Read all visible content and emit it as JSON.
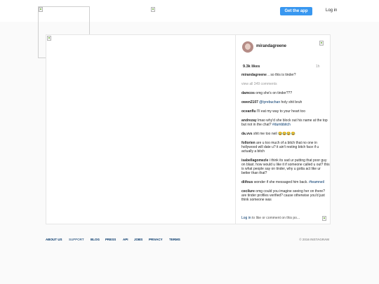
{
  "header": {
    "get_app_label": "Get the app",
    "login_label": "Log in"
  },
  "post": {
    "username": "mirandagreene",
    "likes": "9.3k likes",
    "time": "1h",
    "caption_user": "mirandagreene",
    "caption_text": ".. so this is tinder?",
    "view_all": "view all 349 comments",
    "comments": [
      {
        "user": "damcos",
        "text": "omg she's on tinder???"
      },
      {
        "user": "owen2107",
        "mention": "@tyrebuchan",
        "text": "holy shit bruh"
      },
      {
        "user": "oceanflu",
        "text": "I'll eat my way to your heart too"
      },
      {
        "user": "andrezay",
        "text": "lmao why'd she block out his name at the top but not in the chat?",
        "tag": "#dumbbitch"
      },
      {
        "user": "da.vvs",
        "text": "shit me too neil 😂😂😂😂"
      },
      {
        "user": "follorien",
        "text": "are u too much of a bitch that no one in hollywood will date u? it ain't resting bitch face if u actually a bitch"
      },
      {
        "user": "isabellagomezle",
        "text": "i think its sad ur putting that poor guy on blast. how would u like it if someone called u out? this is what people say on tinder, why u gotta act like ur better than that?"
      },
      {
        "user": "diifous",
        "text": "wonder if she messaged him back.",
        "tag": "#teamneil"
      },
      {
        "user": "cecilure",
        "text": "omg could you imagine seeing her on there? are tinder profiles verified? cause otherwise you'd just think someone was"
      }
    ],
    "login_prompt_link": "Log in",
    "login_prompt_text": "to like or comment on this po..."
  },
  "footer": {
    "links": [
      "ABOUT US",
      "SUPPORT",
      "BLOG",
      "PRESS",
      "API",
      "JOBS",
      "PRIVACY",
      "TERMS"
    ],
    "copyright": "© 2016 INSTAGRAM"
  },
  "colors": {
    "accent": "#3897f0",
    "link": "#003569",
    "muted": "#999999"
  },
  "icons": [
    "broken-image-icon",
    "more-options-icon",
    "save-icon"
  ]
}
